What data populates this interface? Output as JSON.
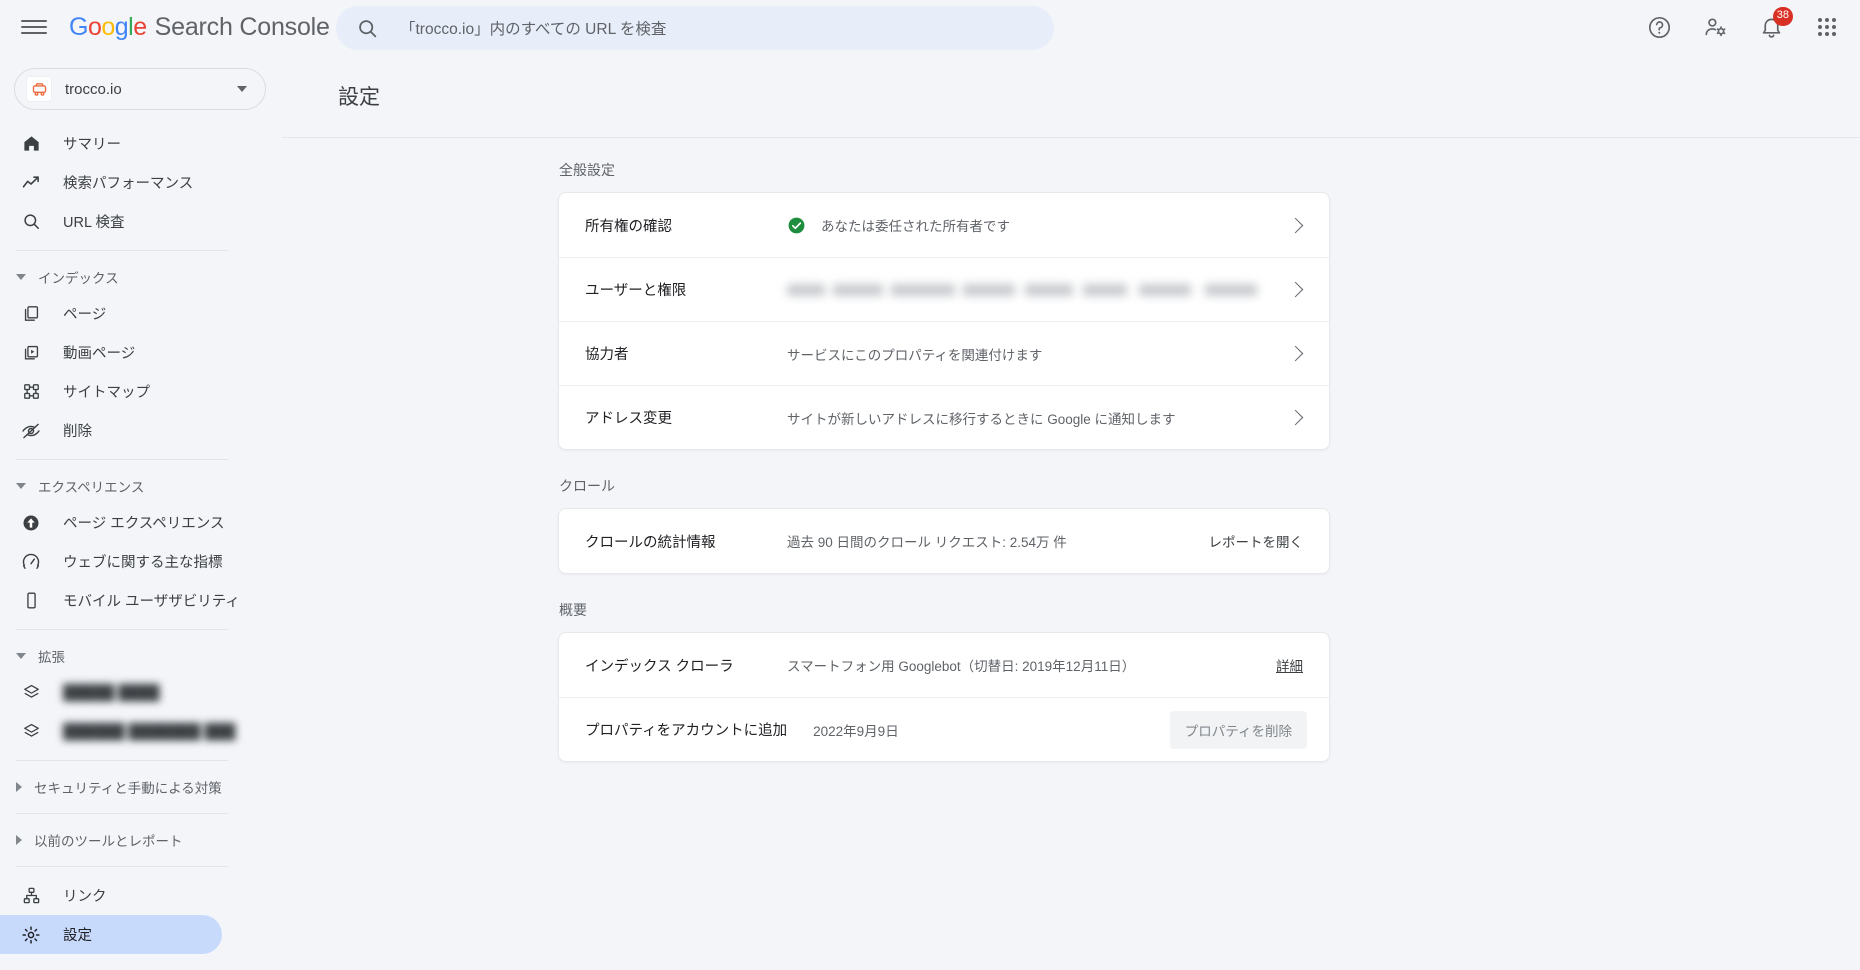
{
  "header": {
    "menu_icon": "hamburger-menu-icon",
    "brand_google": "Google",
    "brand_product": "Search Console",
    "search_placeholder": "「trocco.io」内のすべての URL を検査",
    "search_icon": "search-icon",
    "help_icon": "help-circle-icon",
    "account_settings_icon": "person-gear-icon",
    "notifications_icon": "bell-icon",
    "notifications_badge": "38",
    "apps_icon": "apps-grid-icon"
  },
  "sidebar": {
    "property": {
      "name": "trocco.io",
      "favicon_icon": "trocco-favicon",
      "caret_icon": "chevron-down-icon"
    },
    "top_items": [
      {
        "label": "サマリー",
        "icon": "home-icon"
      },
      {
        "label": "検索パフォーマンス",
        "icon": "trending-up-icon"
      },
      {
        "label": "URL 検査",
        "icon": "search-icon"
      }
    ],
    "index_group": {
      "label": "インデックス",
      "expanded": true
    },
    "index_items": [
      {
        "label": "ページ",
        "icon": "pages-copy-icon"
      },
      {
        "label": "動画ページ",
        "icon": "video-page-icon"
      },
      {
        "label": "サイトマップ",
        "icon": "sitemap-icon"
      },
      {
        "label": "削除",
        "icon": "eye-off-icon"
      }
    ],
    "experience_group": {
      "label": "エクスペリエンス",
      "expanded": true
    },
    "experience_items": [
      {
        "label": "ページ エクスペリエンス",
        "icon": "page-experience-icon"
      },
      {
        "label": "ウェブに関する主な指標",
        "icon": "speedometer-icon"
      },
      {
        "label": "モバイル ユーザザビリティ",
        "icon": "mobile-icon"
      }
    ],
    "extension_group": {
      "label": "拡張",
      "expanded": true
    },
    "extension_items": [
      {
        "label": "█████ ████",
        "icon": "layers-icon",
        "redacted": true
      },
      {
        "label": "██████ ███████ ███",
        "icon": "layers-icon",
        "redacted": true
      }
    ],
    "security_group": {
      "label": "セキュリティと手動による対策",
      "expanded": false
    },
    "legacy_group": {
      "label": "以前のツールとレポート",
      "expanded": false
    },
    "bottom_items": [
      {
        "label": "リンク",
        "icon": "links-icon",
        "active": false
      },
      {
        "label": "設定",
        "icon": "gear-icon",
        "active": true
      }
    ]
  },
  "main": {
    "page_title": "設定",
    "sections": [
      {
        "label": "全般設定",
        "rows": [
          {
            "title": "所有権の確認",
            "value": "あなたは委任された所有者です",
            "status_icon": "check-circle-icon",
            "status_color": "#1e8e3e",
            "action_type": "chevron",
            "action_icon": "chevron-right-icon"
          },
          {
            "title": "ユーザーと権限",
            "value": "",
            "redacted": true,
            "action_type": "chevron",
            "action_icon": "chevron-right-icon"
          },
          {
            "title": "協力者",
            "value": "サービスにこのプロパティを関連付けます",
            "action_type": "chevron",
            "action_icon": "chevron-right-icon"
          },
          {
            "title": "アドレス変更",
            "value": "サイトが新しいアドレスに移行するときに Google に通知します",
            "action_type": "chevron",
            "action_icon": "chevron-right-icon"
          }
        ]
      },
      {
        "label": "クロール",
        "rows": [
          {
            "title": "クロールの統計情報",
            "value": "過去 90 日間のクロール リクエスト: 2.54万 件",
            "action_type": "link",
            "action_label": "レポートを開く"
          }
        ]
      },
      {
        "label": "概要",
        "rows": [
          {
            "title": "インデックス クローラ",
            "value": "スマートフォン用 Googlebot（切替日: 2019年12月11日）",
            "action_type": "link-underline",
            "action_label": "詳細"
          },
          {
            "title": "プロパティをアカウントに追加",
            "value": "2022年9月9日",
            "action_type": "button",
            "action_label": "プロパティを削除"
          }
        ]
      }
    ]
  },
  "colors": {
    "page_bg": "#f3f5f9",
    "card_bg": "#ffffff",
    "accent_blue": "#1a73e8",
    "active_nav": "#c8dafc",
    "badge_red": "#d93025",
    "success_green": "#1e8e3e",
    "text_primary": "#202124",
    "text_secondary": "#5f6368"
  }
}
